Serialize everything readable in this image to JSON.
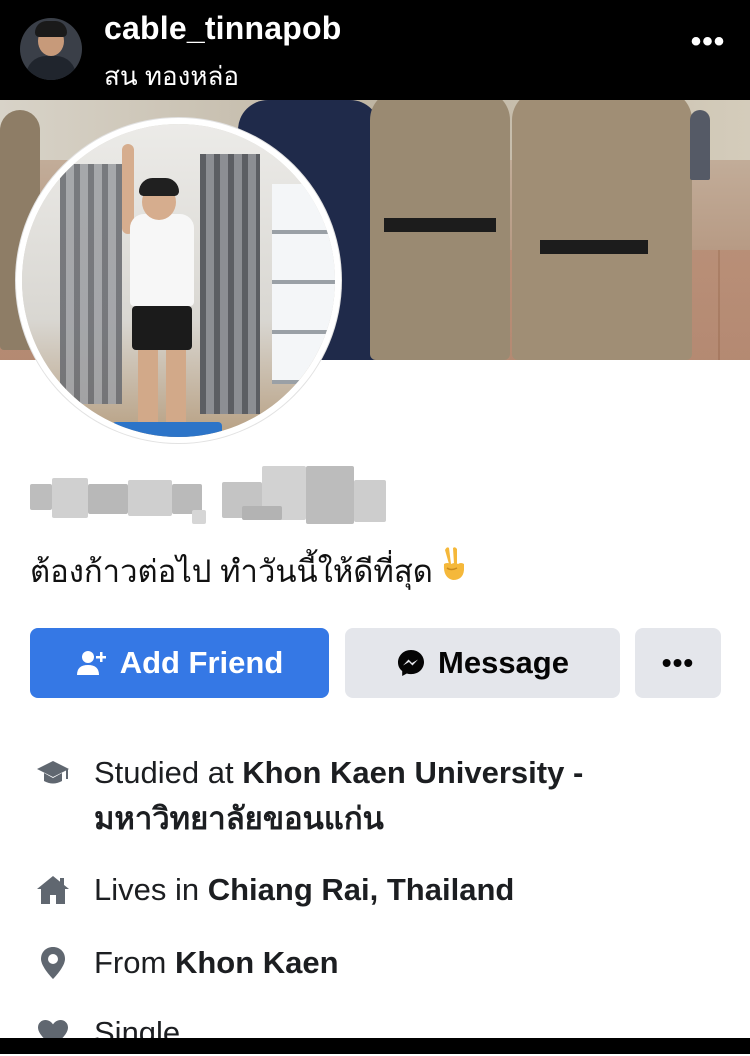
{
  "story": {
    "username": "cable_tinnapob",
    "subtitle": "สน ทองหล่อ",
    "more_label": "•••"
  },
  "profile": {
    "bio": "ต้องก้าวต่อไป ทำวันนี้ให้ดีที่สุด",
    "bio_emoji": "✌"
  },
  "actions": {
    "add_friend": "Add Friend",
    "message": "Message",
    "more": "•••"
  },
  "info": {
    "education_prefix": "Studied at ",
    "education_name": "Khon Kaen University - มหาวิทยาลัยขอนแก่น",
    "lives_prefix": "Lives in ",
    "lives_place": "Chiang Rai, Thailand",
    "from_prefix": "From ",
    "from_place": "Khon Kaen",
    "relationship": "Single"
  },
  "colors": {
    "accent": "#3578e5",
    "button_gray": "#e4e6eb",
    "icon_gray": "#606770"
  },
  "icons": [
    "graduation-cap-icon",
    "home-icon",
    "location-pin-icon",
    "heart-icon",
    "messenger-icon",
    "add-person-icon"
  ]
}
